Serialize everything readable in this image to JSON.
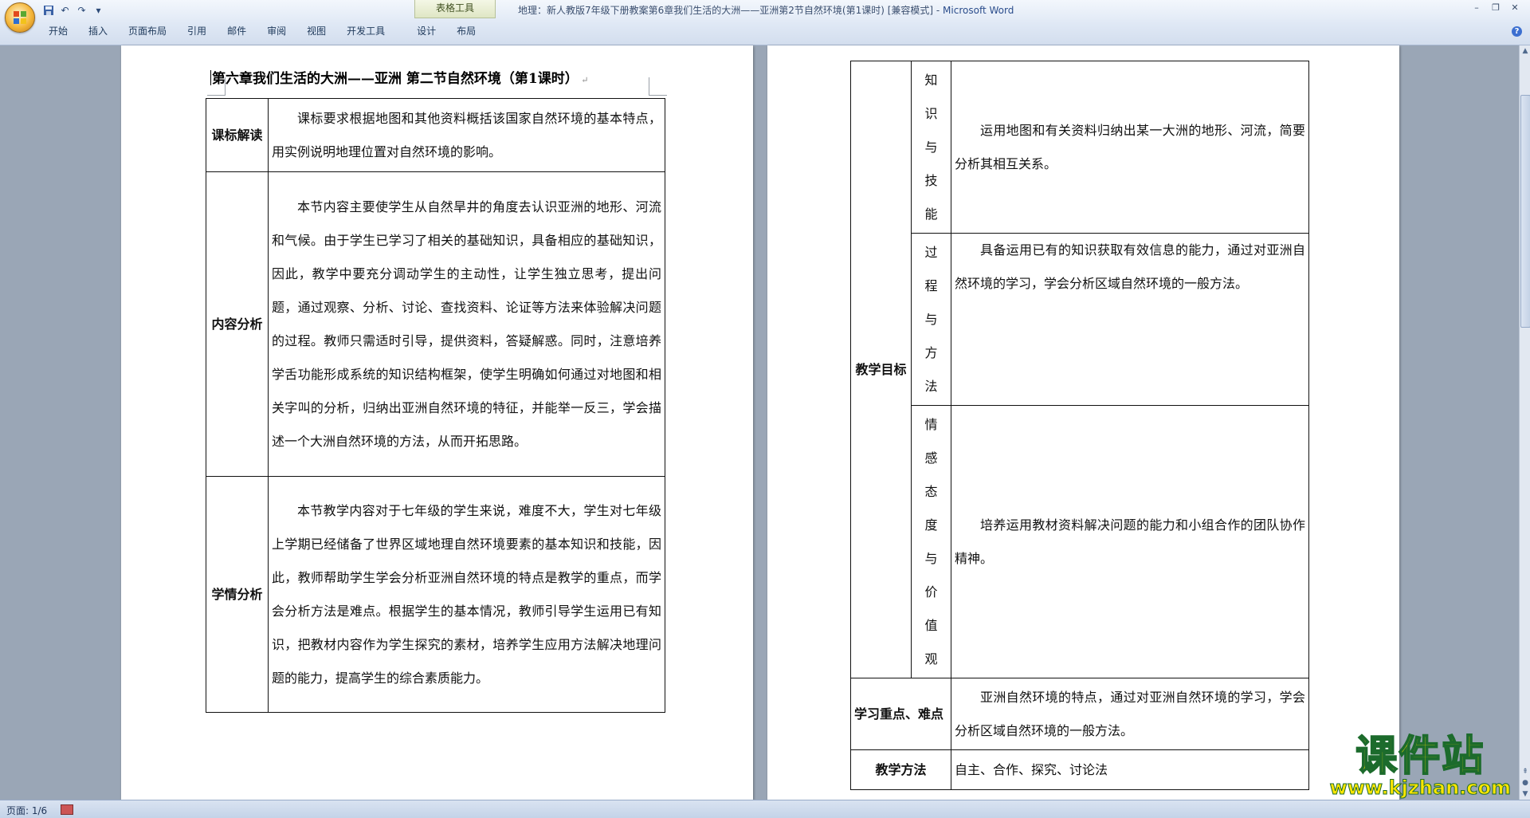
{
  "window": {
    "title": "地理：新人教版7年级下册教案第6章我们生活的大洲——亚洲第2节自然环境(第1课时) [兼容模式] - ",
    "app_name": "Microsoft Word",
    "context_tool_label": "表格工具"
  },
  "quick_access": {
    "save_icon": "save-icon",
    "undo_icon": "undo-icon",
    "redo_icon": "redo-icon",
    "customize_icon": "dropdown-icon"
  },
  "ribbon_tabs": [
    "开始",
    "插入",
    "页面布局",
    "引用",
    "邮件",
    "审阅",
    "视图",
    "开发工具",
    "设计",
    "布局"
  ],
  "document": {
    "heading": "第六章我们生活的大洲——亚洲 第二节自然环境（第1课时）",
    "left_table": [
      {
        "header": "课标解读",
        "text": "课标要求根据地图和其他资料概括该国家自然环境的基本特点，用实例说明地理位置对自然环境的影响。"
      },
      {
        "header": "内容分析",
        "text": "本节内容主要使学生从自然旱井的角度去认识亚洲的地形、河流和气候。由于学生已学习了相关的基础知识，具备相应的基础知识，因此，教学中要充分调动学生的主动性，让学生独立思考，提出问题，通过观察、分析、讨论、查找资料、论证等方法来体验解决问题的过程。教师只需适时引导，提供资料，答疑解惑。同时，注意培养学舌功能形成系统的知识结构框架，使学生明确如何通过对地图和相关字叫的分析，归纳出亚洲自然环境的特征，并能举一反三，学会描述一个大洲自然环境的方法，从而开拓思路。"
      },
      {
        "header": "学情分析",
        "text": "本节教学内容对于七年级的学生来说，难度不大，学生对七年级上学期已经储备了世界区域地理自然环境要素的基本知识和技能，因此，教师帮助学生学会分析亚洲自然环境的特点是教学的重点，而学会分析方法是难点。根据学生的基本情况，教师引导学生运用已有知识，把教材内容作为学生探究的素材，培养学生应用方法解决地理问题的能力，提高学生的综合素质能力。"
      }
    ],
    "right_table": {
      "goal_header": "教学目标",
      "goals": [
        {
          "label": "知识与技能",
          "text": "运用地图和有关资料归纳出某一大洲的地形、河流，简要分析其相互关系。"
        },
        {
          "label": "过程与方法",
          "text": "具备运用已有的知识获取有效信息的能力，通过对亚洲自然环境的学习，学会分析区域自然环境的一般方法。"
        },
        {
          "label": "情感态度与价值观",
          "text": "培养运用教材资料解决问题的能力和小组合作的团队协作精神。"
        }
      ],
      "key_header": "学习重点、难点",
      "key_text": "亚洲自然环境的特点，通过对亚洲自然环境的学习，学会分析区域自然环境的一般方法。",
      "method_header": "教学方法",
      "method_text": "自主、合作、探究、讨论法"
    }
  },
  "status_bar": {
    "page_info": "页面: 1/6"
  },
  "watermark": {
    "title": "课件站",
    "url": "www.kjzhan.com"
  }
}
